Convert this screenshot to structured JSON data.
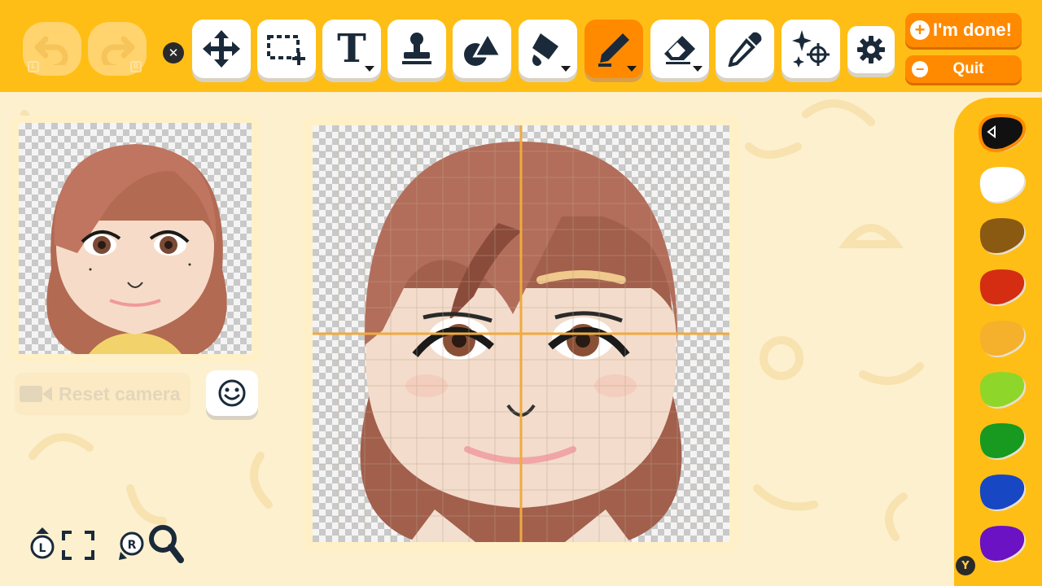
{
  "toolbar": {
    "undo_button": {
      "icon": "undo-arrow-icon",
      "shoulder": "L"
    },
    "redo_button": {
      "icon": "redo-arrow-icon",
      "shoulder": "R"
    },
    "close_glyph": "✕",
    "tools": [
      {
        "name": "move",
        "icon": "move-arrows-icon",
        "active": false
      },
      {
        "name": "select",
        "icon": "selection-icon",
        "active": false
      },
      {
        "name": "text",
        "icon": "text-icon",
        "glyph": "T",
        "active": false
      },
      {
        "name": "stamp",
        "icon": "stamp-icon",
        "active": false
      },
      {
        "name": "shapes",
        "icon": "shapes-icon",
        "active": false
      },
      {
        "name": "fill",
        "icon": "paint-bucket-icon",
        "active": false
      },
      {
        "name": "pen",
        "icon": "pen-icon",
        "active": true
      },
      {
        "name": "eraser",
        "icon": "eraser-icon",
        "active": false
      },
      {
        "name": "eyedropper",
        "icon": "eyedropper-icon",
        "active": false
      },
      {
        "name": "sparkle",
        "icon": "sparkle-icon",
        "active": false
      }
    ],
    "settings_icon": "gear-icon",
    "done_label": "I'm done!",
    "done_glyph": "+",
    "quit_label": "Quit",
    "quit_glyph": "−"
  },
  "preview": {
    "reset_camera_label": "Reset camera",
    "camera_icon": "video-camera-icon",
    "expression_icon": "smiley-face-icon"
  },
  "bottom_nav": {
    "icons": [
      "save-l-icon",
      "fullscreen-icon",
      "zoom-r-icon",
      "magnifier-icon"
    ],
    "l_label": "L",
    "r_label": "R"
  },
  "palette": {
    "selected_index": 0,
    "colors": [
      "#111111",
      "#ffffff",
      "#8a5a12",
      "#d42d12",
      "#f5b02c",
      "#8fd62a",
      "#179a1f",
      "#1747c2",
      "#6a12c4"
    ],
    "y_button": "Y"
  },
  "accent": {
    "toolbar": "#ffbe16",
    "active_tool": "#ff8a00",
    "background": "#fdf0cf"
  }
}
